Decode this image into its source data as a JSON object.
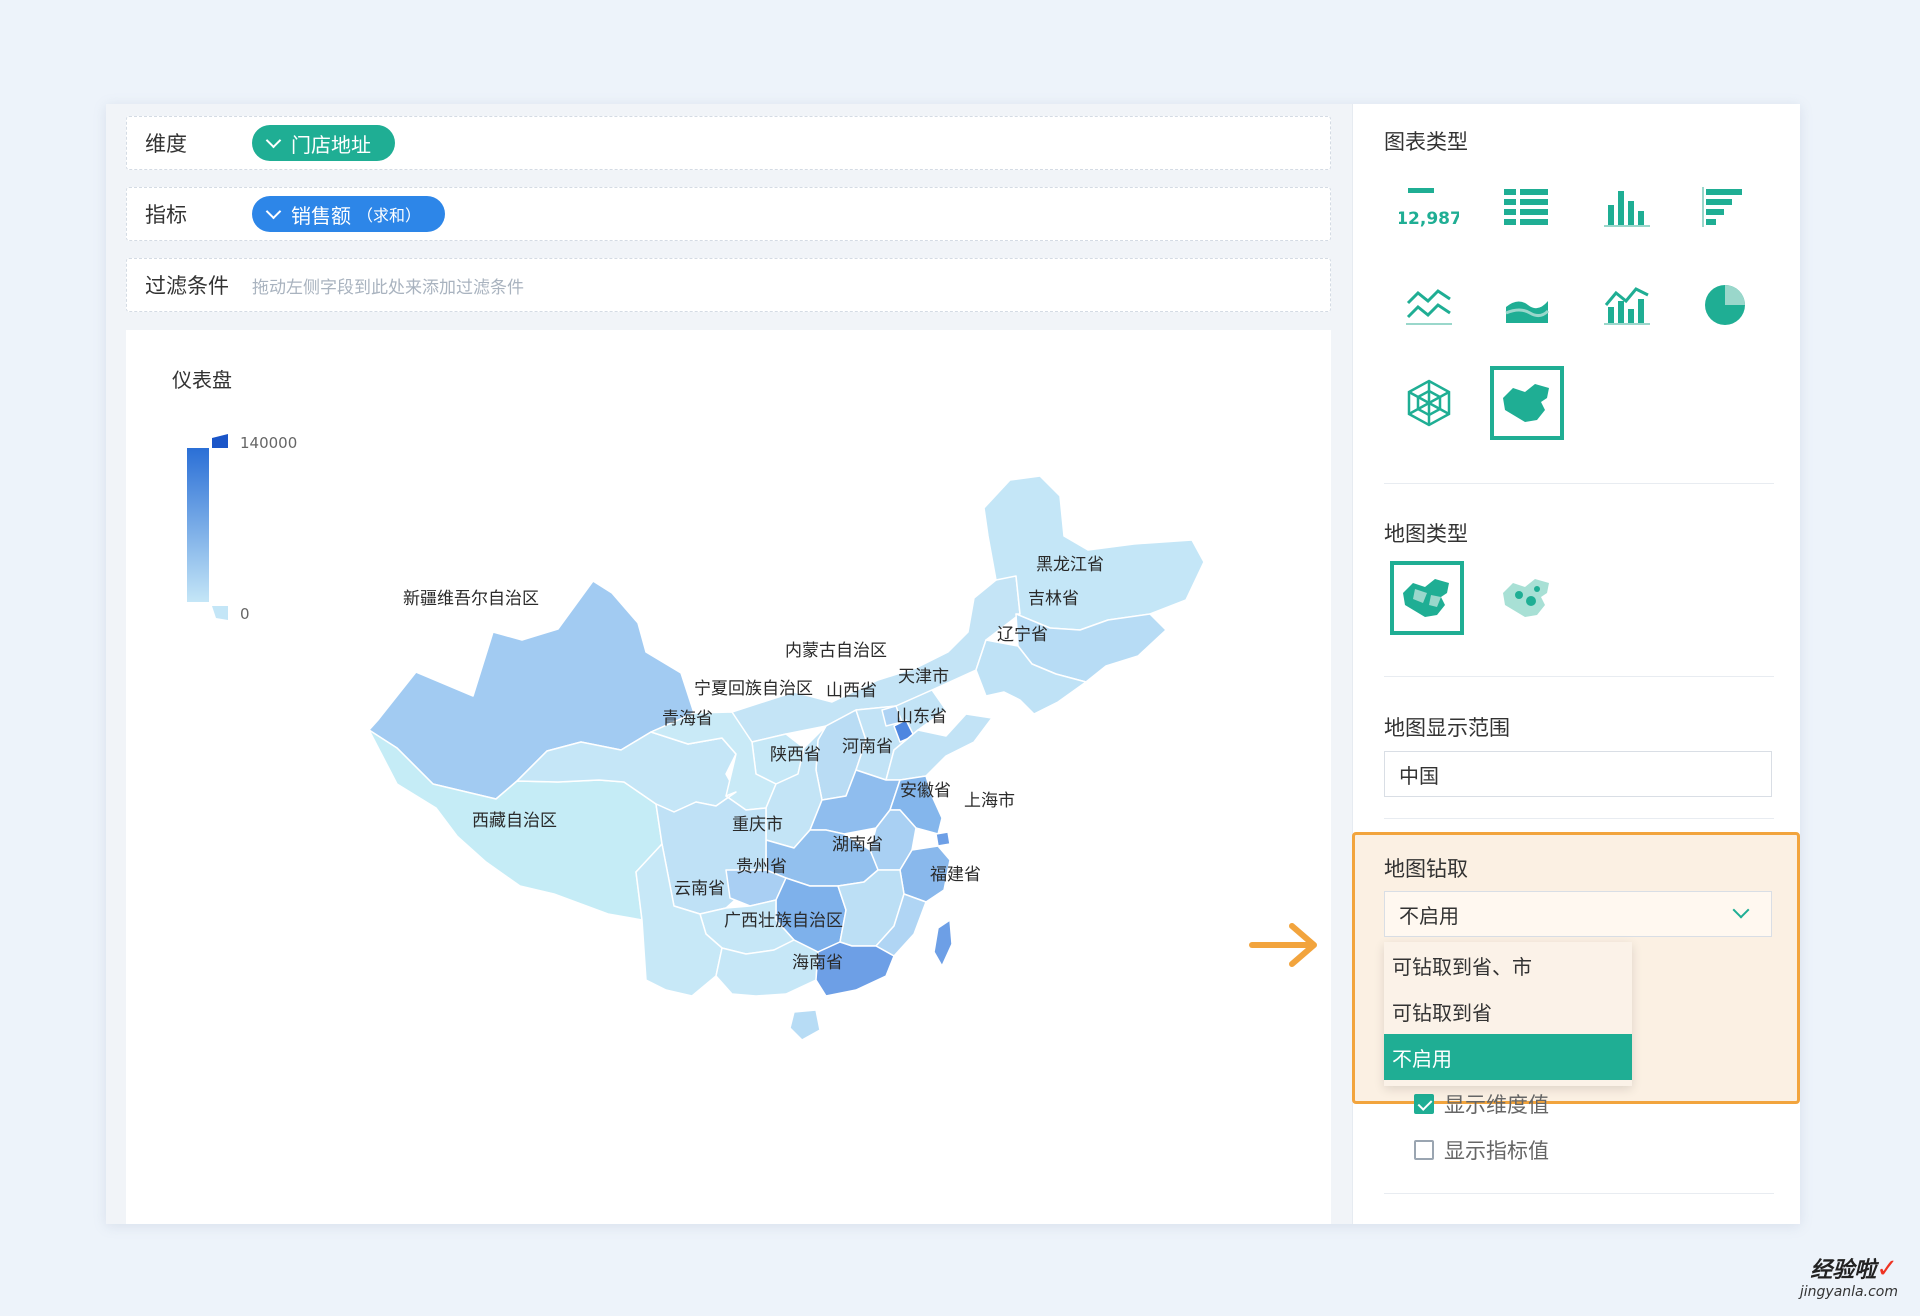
{
  "fields": {
    "dimension": {
      "label": "维度",
      "pill": "门店地址"
    },
    "metric": {
      "label": "指标",
      "pill": "销售额",
      "agg": "（求和）"
    },
    "filter": {
      "label": "过滤条件",
      "placeholder": "拖动左侧字段到此处来添加过滤条件"
    }
  },
  "chart": {
    "title": "仪表盘",
    "legend": {
      "max": "140000",
      "min": "0",
      "high_color": "#2a6fd6",
      "low_color": "#c4e6f7"
    }
  },
  "chart_data": {
    "type": "map",
    "title": "仪表盘",
    "scale_range": [
      0,
      140000
    ],
    "regions": [
      {
        "name": "新疆维吾尔自治区",
        "level": 0.45
      },
      {
        "name": "西藏自治区",
        "level": 0.12
      },
      {
        "name": "青海省",
        "level": 0.15
      },
      {
        "name": "内蒙古自治区",
        "level": 0.15
      },
      {
        "name": "黑龙江省",
        "level": 0.2
      },
      {
        "name": "吉林省",
        "level": 0.2
      },
      {
        "name": "辽宁省",
        "level": 0.22
      },
      {
        "name": "宁夏回族自治区",
        "level": 0.15
      },
      {
        "name": "山西省",
        "level": 0.22
      },
      {
        "name": "天津市",
        "level": 0.55
      },
      {
        "name": "山东省",
        "level": 0.3
      },
      {
        "name": "陕西省",
        "level": 0.22
      },
      {
        "name": "河南省",
        "level": 0.45
      },
      {
        "name": "安徽省",
        "level": 0.35
      },
      {
        "name": "上海市",
        "level": 0.7
      },
      {
        "name": "重庆市",
        "level": 0.3
      },
      {
        "name": "湖南省",
        "level": 0.55
      },
      {
        "name": "贵州省",
        "level": 0.22
      },
      {
        "name": "福建省",
        "level": 0.3
      },
      {
        "name": "云南省",
        "level": 0.2
      },
      {
        "name": "广西壮族自治区",
        "level": 0.2
      },
      {
        "name": "海南省",
        "level": 0.3
      }
    ]
  },
  "panel": {
    "chart_type_title": "图表类型",
    "kpi_number": "12,987",
    "chart_icons": [
      "kpi-icon",
      "table-icon",
      "bar-chart-icon",
      "horizontal-bar-icon",
      "line-chart-icon",
      "area-chart-icon",
      "combo-chart-icon",
      "pie-chart-icon",
      "radar-chart-icon",
      "map-chart-icon"
    ],
    "map_type_title": "地图类型",
    "map_range_title": "地图显示范围",
    "map_range_value": "中国",
    "drill_title": "地图钻取",
    "drill_value": "不启用",
    "drill_options": [
      "可钻取到省、市",
      "可钻取到省",
      "不启用"
    ],
    "show_dimension": "显示维度值",
    "show_metric": "显示指标值"
  },
  "colors": {
    "accent": "#1fae94",
    "blue": "#2d86e8",
    "highlight": "#f2a43d"
  },
  "watermark": {
    "main": "经验啦",
    "sub": "jingyanla.com"
  }
}
